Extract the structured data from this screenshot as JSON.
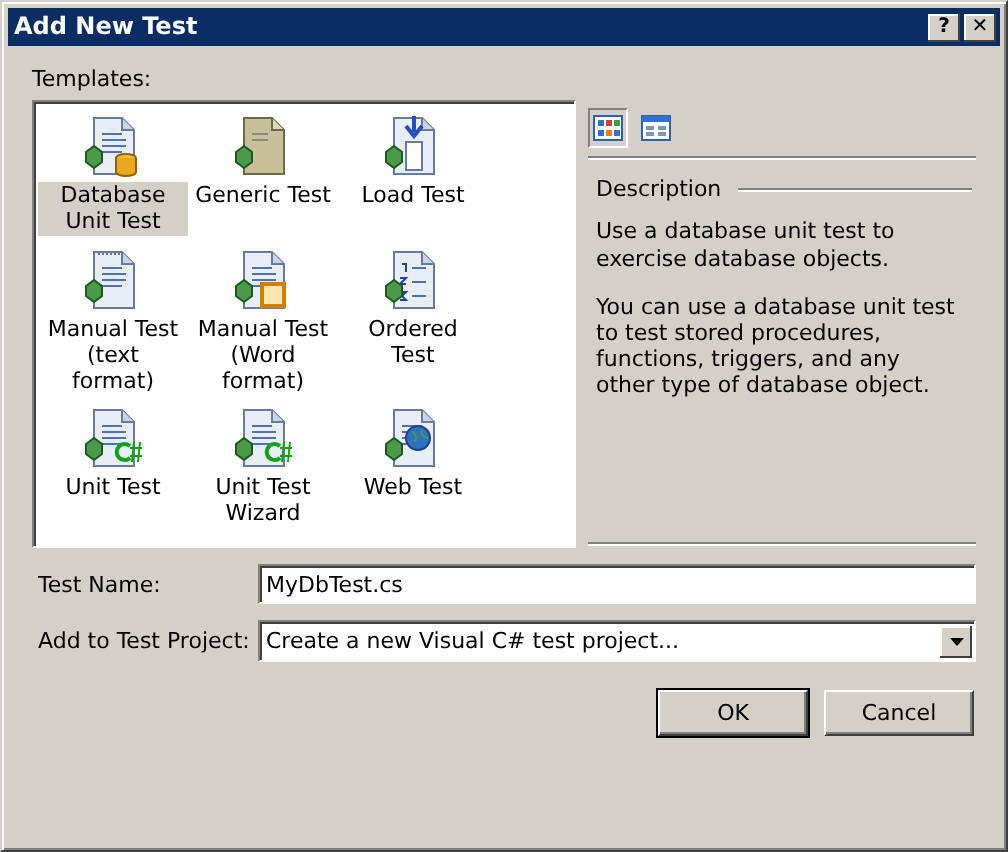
{
  "window": {
    "title": "Add New Test",
    "title_buttons": [
      "?",
      "✕"
    ]
  },
  "templates_label": "Templates:",
  "templates": [
    {
      "kind": "database",
      "label": "Database Unit Test",
      "selected": true
    },
    {
      "kind": "generic",
      "label": "Generic Test",
      "selected": false
    },
    {
      "kind": "load",
      "label": "Load Test",
      "selected": false
    },
    {
      "kind": "manual-text",
      "label": "Manual Test (text format)",
      "selected": false
    },
    {
      "kind": "manual-word",
      "label": "Manual Test (Word format)",
      "selected": false
    },
    {
      "kind": "ordered",
      "label": "Ordered Test",
      "selected": false
    },
    {
      "kind": "unit",
      "label": "Unit Test",
      "selected": false
    },
    {
      "kind": "wizard",
      "label": "Unit Test Wizard",
      "selected": false
    },
    {
      "kind": "web",
      "label": "Web Test",
      "selected": false
    }
  ],
  "view_buttons": [
    {
      "kind": "large-icons",
      "selected": true
    },
    {
      "kind": "small-icons",
      "selected": false
    }
  ],
  "description": {
    "heading": "Description",
    "paragraphs": [
      "Use a database unit test to exercise database objects.",
      "You can use a database unit test to test stored procedures, functions, triggers, and any other type of database object."
    ]
  },
  "test_name": {
    "label": "Test Name:",
    "value": "MyDbTest.cs"
  },
  "test_project": {
    "label": "Add to Test Project:",
    "value": "Create a new Visual C# test project..."
  },
  "buttons": [
    {
      "kind": "default",
      "label": "OK"
    },
    {
      "kind": "normal",
      "label": "Cancel"
    }
  ]
}
